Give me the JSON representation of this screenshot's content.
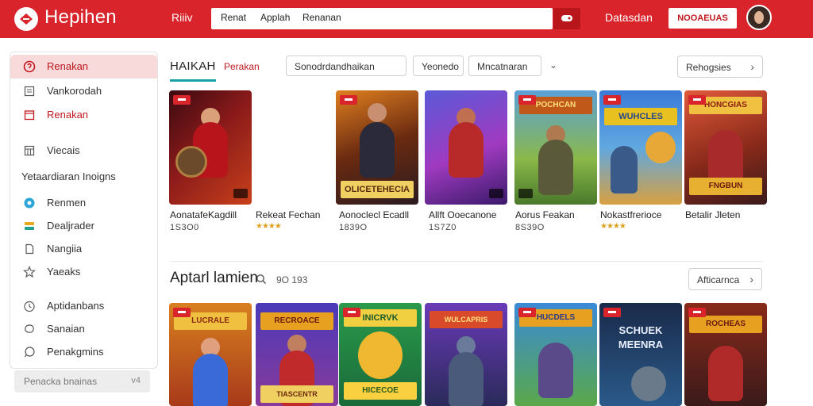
{
  "header": {
    "logo_text": "Hepihen",
    "link_left": "Riiiv",
    "search_tabs": [
      "Renat",
      "Applah",
      "Renanan"
    ],
    "link_right": "Datasdan",
    "signup_label": "NOOAEUAS",
    "brand_color": "#d8242a"
  },
  "sidebar": {
    "items_top": [
      {
        "label": "Renakan",
        "icon": "info-icon",
        "active": true
      },
      {
        "label": "Vankorodah",
        "icon": "list-icon"
      },
      {
        "label": "Renakan",
        "icon": "calendar-icon",
        "red": true
      }
    ],
    "item_views": {
      "label": "Viecais",
      "icon": "grid-icon"
    },
    "heading": "Yetaardiaran Inoigns",
    "items_mid": [
      {
        "label": "Renmen",
        "icon": "circle-icon"
      },
      {
        "label": "Dealjrader",
        "icon": "chat-icon"
      },
      {
        "label": "Nangiia",
        "icon": "document-icon"
      },
      {
        "label": "Yaeaks",
        "icon": "star-icon"
      }
    ],
    "items_bottom": [
      {
        "label": "Aptidanbans",
        "icon": "clock-icon"
      },
      {
        "label": "Sanaian",
        "icon": "bubble-icon"
      },
      {
        "label": "Penakgmins",
        "icon": "message-icon"
      }
    ],
    "footer_label": "Penacka bnainas",
    "footer_arrow": "v4"
  },
  "filters": {
    "tab_main": "HAIKAH",
    "tab_second": "Perakan",
    "search_value": "Sonodrdandhaikan",
    "select_1": "Yeonedo",
    "select_2": "Mncatnaran",
    "right_button": "Rehogsies"
  },
  "games_row1": [
    {
      "title": "AonatafeKagdill",
      "count": "1S3O0",
      "stars": ""
    },
    {
      "title": "Rekeat Fechan",
      "count": "",
      "stars": "★★★★"
    },
    {
      "title": "Aonoclecl Ecadll",
      "count": "1839O",
      "stars": ""
    },
    {
      "title": "Allft Ooecanone",
      "count": "1S7Z0",
      "stars": ""
    },
    {
      "title": "Aorus Feakan",
      "count": "8S39O",
      "stars": ""
    },
    {
      "title": "Nokastfrerioce",
      "count": "",
      "stars": "★★★★"
    },
    {
      "title": "Betalir Jleten",
      "count": "",
      "stars": ""
    }
  ],
  "card_texts": {
    "card2_banner": "OLICETEHECIA",
    "card4_banner": "POCHCAN",
    "card5_banner": "WUHCLES",
    "card6_banner": "HONCGIAS",
    "card6_bottom": "FNGBUN"
  },
  "section": {
    "title": "Aptarl lamien",
    "count": "9O 193",
    "button": "Afticarnca"
  },
  "games_row2_banners": [
    "LUCRALE",
    "RECROACE",
    "INICRVK",
    "WULCAPRIS",
    "HUCDELS",
    "SCHUEK MEENRA",
    "ROCHEAS"
  ],
  "card2_row2_bottom": "TIASCENTR",
  "card3_row2_bottom": "HICECOE"
}
